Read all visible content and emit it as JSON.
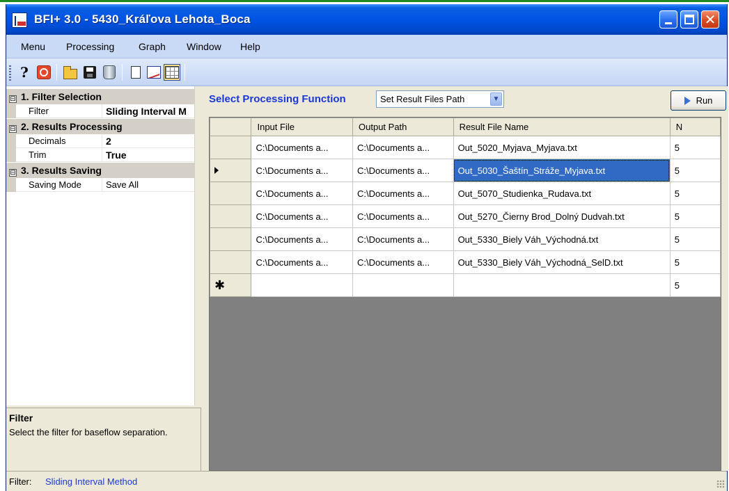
{
  "window": {
    "title": "BFI+ 3.0 - 5430_Kráľova Lehota_Boca",
    "minimize": "",
    "maximize": "",
    "close": "✕"
  },
  "menu": {
    "items": [
      "Menu",
      "Processing",
      "Graph",
      "Window",
      "Help"
    ]
  },
  "toolbar": {
    "buttons": [
      "help-icon",
      "stop-icon",
      "open-folder-icon",
      "save-disk-icon",
      "recycle-bin-icon",
      "new-page-icon",
      "graph-icon",
      "grid-settings-icon"
    ]
  },
  "properties": {
    "categories": [
      {
        "label": "1. Filter Selection",
        "expander": "⊟"
      },
      {
        "label": "2. Results Processing",
        "expander": "⊟"
      },
      {
        "label": "3. Results Saving",
        "expander": "⊟"
      }
    ],
    "rows": [
      {
        "name": "Filter",
        "value": "Sliding Interval M"
      },
      {
        "name": "Decimals",
        "value": "2"
      },
      {
        "name": "Trim",
        "value": "True"
      },
      {
        "name": "Saving Mode",
        "value": "Save All"
      }
    ]
  },
  "help": {
    "title": "Filter",
    "description": "Select the filter for baseflow separation."
  },
  "processing": {
    "label": "Select Processing Function",
    "selected_function": "Set Result Files Path",
    "run_label": "Run"
  },
  "grid": {
    "columns": [
      "Input File",
      "Output Path",
      "Result File Name",
      "N"
    ],
    "rows": [
      [
        "C:\\Documents a...",
        "C:\\Documents a...",
        "Out_5020_Myjava_Myjava.txt",
        "5"
      ],
      [
        "C:\\Documents a...",
        "C:\\Documents a...",
        "Out_5030_Šaštín_Stráže_Myjava.txt",
        "5"
      ],
      [
        "C:\\Documents a...",
        "C:\\Documents a...",
        "Out_5070_Studienka_Rudava.txt",
        "5"
      ],
      [
        "C:\\Documents a...",
        "C:\\Documents a...",
        "Out_5270_Čierny Brod_Dolný Dudvah.txt",
        "5"
      ],
      [
        "C:\\Documents a...",
        "C:\\Documents a...",
        "Out_5330_Biely Váh_Východná.txt",
        "5"
      ],
      [
        "C:\\Documents a...",
        "C:\\Documents a...",
        "Out_5330_Biely Váh_Východná_SelD.txt",
        "5"
      ]
    ],
    "new_row": {
      "marker": "✱",
      "n": "5"
    },
    "selected_row": 1,
    "selected_col": 2
  },
  "status": {
    "label": "Filter:",
    "value": "Sliding Interval Method"
  },
  "colors": {
    "title_blue": "#0054e3",
    "accent_text": "#1b38d6",
    "selection": "#316ac5"
  }
}
